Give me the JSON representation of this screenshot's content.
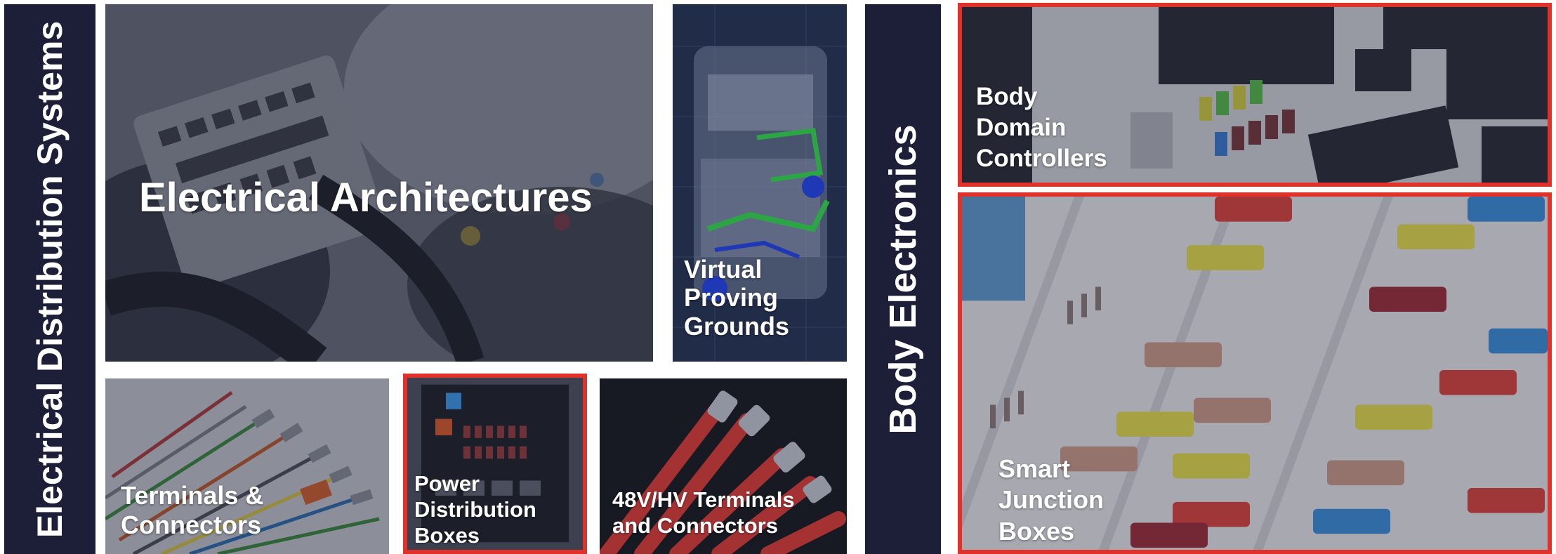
{
  "left_banner": {
    "title": "Electrical Distribution Systems"
  },
  "right_banner": {
    "title": "Body Electronics"
  },
  "tiles": {
    "electrical_architectures": {
      "label": "Electrical Architectures"
    },
    "virtual_proving_grounds": {
      "lines": [
        "Virtual",
        "Proving",
        "Grounds"
      ]
    },
    "terminals_connectors": {
      "lines": [
        "Terminals &",
        "Connectors"
      ]
    },
    "power_distribution_boxes": {
      "lines": [
        "Power",
        "Distribution",
        "Boxes"
      ],
      "highlighted": true
    },
    "hv_terminals": {
      "lines": [
        "48V/HV Terminals",
        "and Connectors"
      ]
    },
    "body_domain_controllers": {
      "lines": [
        "Body",
        "Domain",
        "Controllers"
      ],
      "highlighted": true
    },
    "smart_junction_boxes": {
      "lines": [
        "Smart",
        "Junction",
        "Boxes"
      ],
      "highlighted": true
    }
  },
  "colors": {
    "banner": "#1c1f37",
    "highlight": "#e0312b",
    "text": "#ffffff"
  }
}
